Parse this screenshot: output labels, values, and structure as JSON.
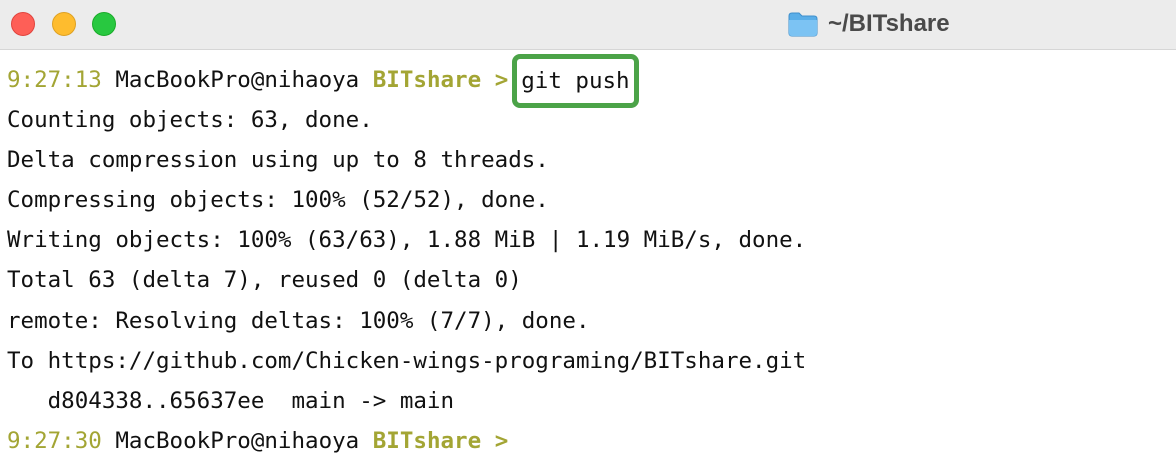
{
  "window": {
    "title": "~/BITshare",
    "icon": "folder-icon",
    "traffic_lights": {
      "close_color": "#fe5f57",
      "minimize_color": "#febc2e",
      "zoom_color": "#28c840"
    }
  },
  "prompt1": {
    "time": "9:27:13",
    "host": "MacBookPro@nihaoya",
    "dir": "BITshare",
    "arrow": ">",
    "command": "git push"
  },
  "output": [
    "Counting objects: 63, done.",
    "Delta compression using up to 8 threads.",
    "Compressing objects: 100% (52/52), done.",
    "Writing objects: 100% (63/63), 1.88 MiB | 1.19 MiB/s, done.",
    "Total 63 (delta 7), reused 0 (delta 0)",
    "remote: Resolving deltas: 100% (7/7), done.",
    "To https://github.com/Chicken-wings-programing/BITshare.git",
    "   d804338..65637ee  main -> main"
  ],
  "prompt2": {
    "time": "9:27:30",
    "host": "MacBookPro@nihaoya",
    "dir": "BITshare",
    "arrow": ">"
  },
  "colors": {
    "prompt_accent": "#a3a534",
    "highlight_box": "#4ba348"
  }
}
